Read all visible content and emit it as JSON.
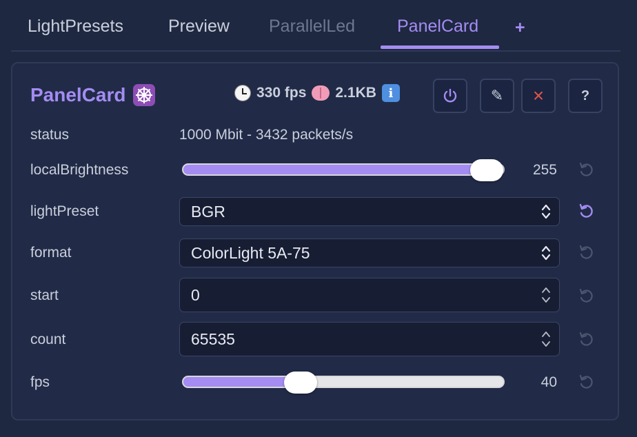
{
  "tabs": [
    {
      "label": "LightPresets",
      "state": "normal"
    },
    {
      "label": "Preview",
      "state": "normal"
    },
    {
      "label": "ParallelLed",
      "state": "disabled"
    },
    {
      "label": "PanelCard",
      "state": "active"
    }
  ],
  "add_tab_label": "+",
  "card": {
    "title": "PanelCard",
    "title_icon": "wheel-icon",
    "fps_text": "330 fps",
    "memory_text": "2.1KB",
    "info_glyph": "i",
    "buttons": {
      "power": "power-icon",
      "edit_glyph": "✎",
      "close_glyph": "×",
      "help_glyph": "?"
    }
  },
  "rows": {
    "status": {
      "label": "status",
      "value": "1000 Mbit - 3432 packets/s"
    },
    "localBrightness": {
      "label": "localBrightness",
      "value": "255",
      "level": 1.0
    },
    "lightPreset": {
      "label": "lightPreset",
      "value": "BGR"
    },
    "format": {
      "label": "format",
      "value": "ColorLight 5A-75"
    },
    "start": {
      "label": "start",
      "value": "0"
    },
    "count": {
      "label": "count",
      "value": "65535"
    },
    "fps": {
      "label": "fps",
      "value": "40",
      "level": 0.35
    }
  },
  "colors": {
    "accent": "#a48cf2",
    "background": "#1e2841",
    "close": "#e0554a"
  }
}
